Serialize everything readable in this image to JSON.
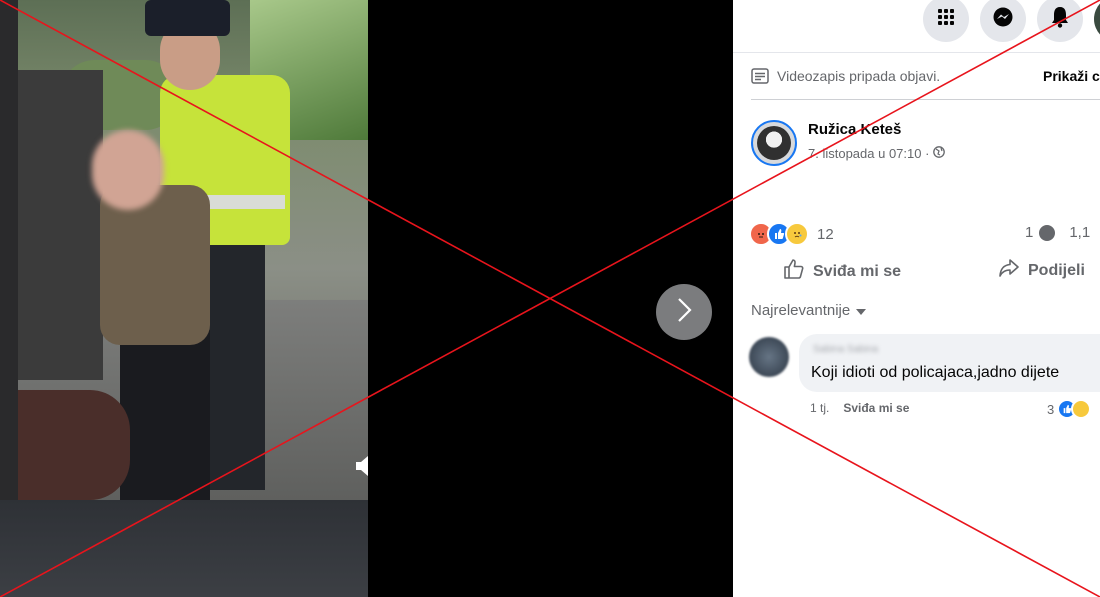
{
  "video": {
    "next_icon": "chevron-right-icon",
    "volume_icon": "volume-icon"
  },
  "topbar": {
    "menu_icon": "grid-menu-icon",
    "messenger_icon": "messenger-icon",
    "notifications_icon": "bell-icon"
  },
  "notice": {
    "text": "Videozapis pripada objavi.",
    "link": "Prikaži c"
  },
  "post": {
    "author": "Ružica Keteš",
    "date": "7. listopada u 07:10 ·",
    "reaction_count": "12",
    "comment_count": "1",
    "share_count": "1,1",
    "like_label": "Sviđa mi se",
    "share_label": "Podijeli"
  },
  "comments": {
    "sort_label": "Najrelevantnije",
    "items": [
      {
        "author": "Sabina Sabina",
        "text": "Koji idioti od policajaca,jadno dijete",
        "time": "1 tj.",
        "like": "Sviđa mi se",
        "reactions": "3"
      }
    ]
  },
  "colors": {
    "accent": "#1877f2",
    "text_secondary": "#65676b",
    "cross": "#e8141c"
  }
}
